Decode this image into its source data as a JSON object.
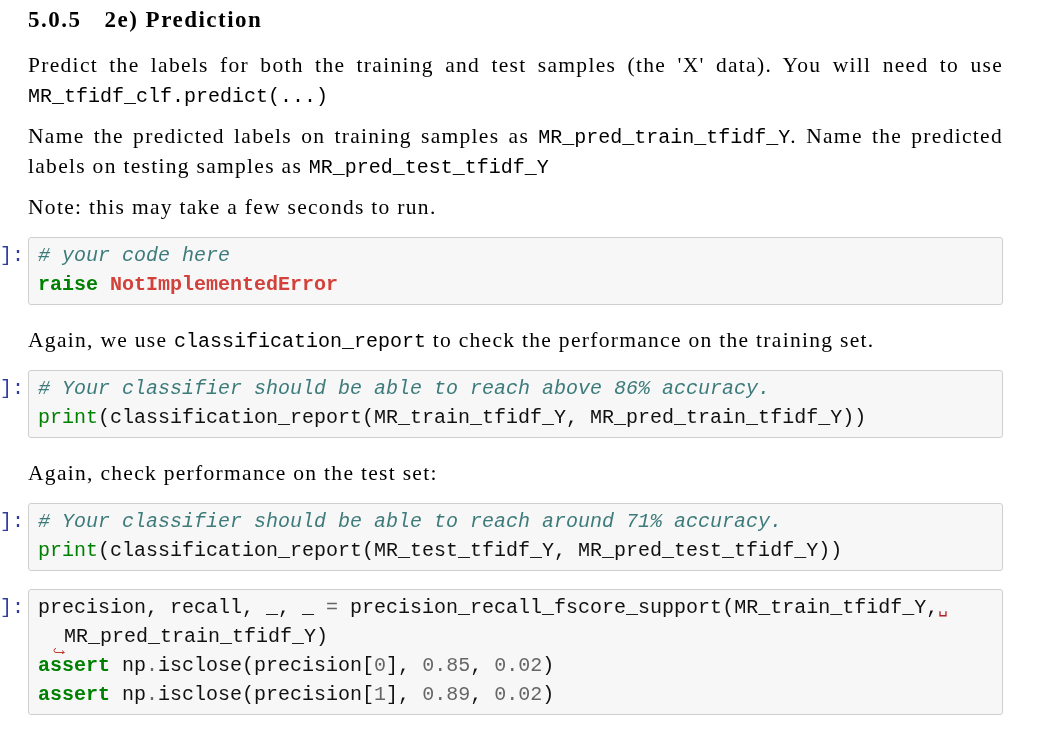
{
  "section": {
    "number": "5.0.5",
    "title": "2e) Prediction"
  },
  "cells": [
    {
      "kind": "markdown",
      "segments": [
        {
          "kind": "text",
          "text": "Predict the labels for both the training and test samples (the 'X' data). You will need to use "
        },
        {
          "kind": "code",
          "text": "MR_tfidf_clf.predict(...)"
        }
      ]
    },
    {
      "kind": "markdown",
      "segments": [
        {
          "kind": "text",
          "text": "Name the predicted labels on training samples as "
        },
        {
          "kind": "code",
          "text": "MR_pred_train_tfidf_Y"
        },
        {
          "kind": "text",
          "text": ". Name the predicted labels on testing samples as "
        },
        {
          "kind": "code",
          "text": "MR_pred_test_tfidf_Y"
        }
      ]
    },
    {
      "kind": "markdown",
      "segments": [
        {
          "kind": "text",
          "text": "Note: this may take a few seconds to run."
        }
      ]
    },
    {
      "kind": "code",
      "prompt": "]:",
      "lines": [
        {
          "tokens": [
            {
              "kind": "comment",
              "text": "# your code here"
            }
          ]
        },
        {
          "tokens": [
            {
              "kind": "keyword",
              "text": "raise"
            },
            {
              "kind": "exception",
              "text": " NotImplementedError"
            }
          ]
        }
      ]
    },
    {
      "kind": "markdown",
      "segments": [
        {
          "kind": "text",
          "text": "Again, we use "
        },
        {
          "kind": "code",
          "text": "classification_report"
        },
        {
          "kind": "text",
          "text": " to check the performance on the training set."
        }
      ]
    },
    {
      "kind": "code",
      "prompt": "]:",
      "lines": [
        {
          "tokens": [
            {
              "kind": "comment",
              "text": "# Your classifier should be able to reach above 86% accuracy."
            }
          ]
        },
        {
          "tokens": [
            {
              "kind": "builtin",
              "text": "print"
            },
            {
              "kind": "name",
              "text": "(classification_report(MR_train_tfidf_Y, MR_pred_train_tfidf_Y))"
            }
          ]
        }
      ]
    },
    {
      "kind": "markdown",
      "segments": [
        {
          "kind": "text",
          "text": "Again, check performance on the test set:"
        }
      ]
    },
    {
      "kind": "code",
      "prompt": "]:",
      "lines": [
        {
          "tokens": [
            {
              "kind": "comment",
              "text": "# Your classifier should be able to reach around 71% accuracy."
            }
          ]
        },
        {
          "tokens": [
            {
              "kind": "builtin",
              "text": "print"
            },
            {
              "kind": "name",
              "text": "(classification_report(MR_test_tfidf_Y, MR_pred_test_tfidf_Y))"
            }
          ]
        }
      ]
    },
    {
      "kind": "code",
      "prompt": "]:",
      "lines": [
        {
          "tokens": [
            {
              "kind": "name",
              "text": "precision, recall, _, _ "
            },
            {
              "kind": "operator",
              "text": "="
            },
            {
              "kind": "name",
              "text": " precision_recall_fscore_support(MR_train_tfidf_Y,"
            },
            {
              "kind": "wrap_mark",
              "text": "␣"
            }
          ],
          "continued": [
            {
              "kind": "name",
              "text": "MR_pred_train_tfidf_Y)"
            }
          ]
        },
        {
          "tokens": [
            {
              "kind": "keyword",
              "text": "assert"
            },
            {
              "kind": "name",
              "text": " np"
            },
            {
              "kind": "operator",
              "text": "."
            },
            {
              "kind": "name",
              "text": "isclose(precision["
            },
            {
              "kind": "number",
              "text": "0"
            },
            {
              "kind": "name",
              "text": "], "
            },
            {
              "kind": "number",
              "text": "0.85"
            },
            {
              "kind": "name",
              "text": ", "
            },
            {
              "kind": "number",
              "text": "0.02"
            },
            {
              "kind": "name",
              "text": ")"
            }
          ]
        },
        {
          "tokens": [
            {
              "kind": "keyword",
              "text": "assert"
            },
            {
              "kind": "name",
              "text": " np"
            },
            {
              "kind": "operator",
              "text": "."
            },
            {
              "kind": "name",
              "text": "isclose(precision["
            },
            {
              "kind": "number",
              "text": "1"
            },
            {
              "kind": "name",
              "text": "], "
            },
            {
              "kind": "number",
              "text": "0.89"
            },
            {
              "kind": "name",
              "text": ", "
            },
            {
              "kind": "number",
              "text": "0.02"
            },
            {
              "kind": "name",
              "text": ")"
            }
          ]
        }
      ]
    }
  ]
}
